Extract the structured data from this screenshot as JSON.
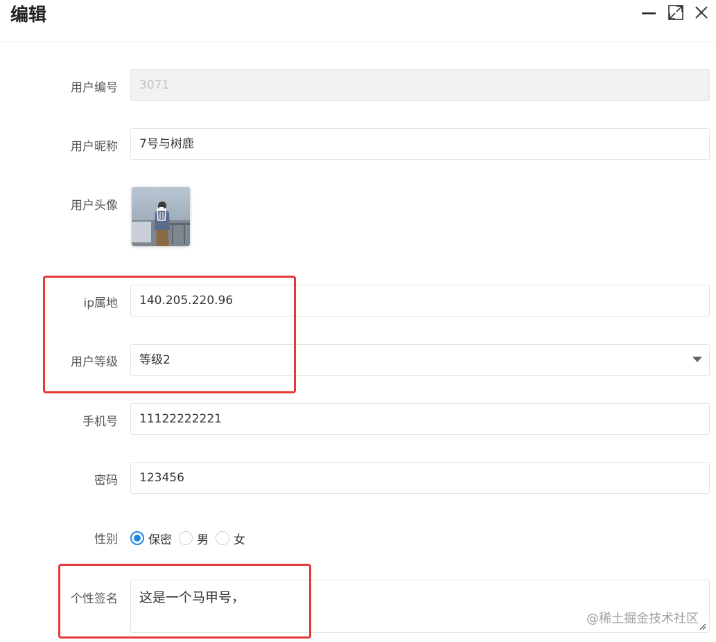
{
  "dialog": {
    "title": "编辑"
  },
  "form": {
    "user_id": {
      "label": "用户编号",
      "value": "3071"
    },
    "nickname": {
      "label": "用户昵称",
      "value": "7号与树鹿"
    },
    "avatar": {
      "label": "用户头像"
    },
    "ip": {
      "label": "ip属地",
      "value": "140.205.220.96"
    },
    "level": {
      "label": "用户等级",
      "value": "等级2"
    },
    "phone": {
      "label": "手机号",
      "value": "11122222221"
    },
    "password": {
      "label": "密码",
      "value": "123456"
    },
    "gender": {
      "label": "性别",
      "options": [
        "保密",
        "男",
        "女"
      ],
      "selected": "保密"
    },
    "signature": {
      "label": "个性签名",
      "value": "这是一个马甲号，"
    }
  },
  "watermark": "@稀土掘金技术社区",
  "colors": {
    "accent": "#1e88e5",
    "highlight": "#e53935",
    "disabled_bg": "#f2f2f2"
  }
}
